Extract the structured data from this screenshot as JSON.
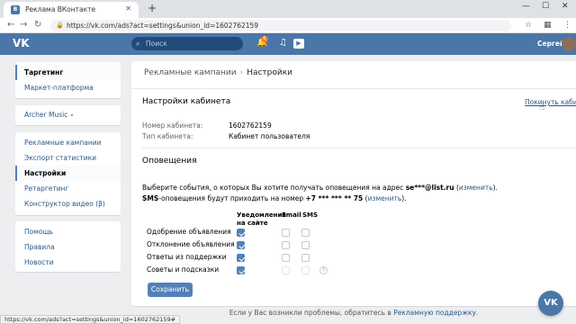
{
  "browser": {
    "tab_title": "Реклама ВКонтакте",
    "url": "https://vk.com/ads?act=settings&union_id=1602762159",
    "status_url": "https://vk.com/ads?act=settings&union_id=1602762159#"
  },
  "header": {
    "logo": "VK",
    "search_placeholder": "Поиск",
    "notifications_count": "6",
    "username": "Сергей",
    "brand_color": "#4a76a8"
  },
  "sidebar": {
    "group1": [
      "Таргетинг",
      "Маркет-платформа"
    ],
    "account": "Archer Music",
    "group2": [
      "Рекламные кампании",
      "Экспорт статистики",
      "Настройки",
      "Ретаргетинг",
      "Конструктор видео (β)"
    ],
    "group3": [
      "Помощь",
      "Правила",
      "Новости"
    ]
  },
  "main": {
    "breadcrumb": [
      "Рекламные кампании",
      "Настройки"
    ],
    "cabinet_settings_title": "Настройки кабинета",
    "leave_link": "Покинуть кабинет",
    "cabinet_number_label": "Номер кабинета:",
    "cabinet_number_value": "1602762159",
    "cabinet_type_label": "Тип кабинета:",
    "cabinet_type_value": "Кабинет пользователя",
    "notifications_title": "Оповещения",
    "email_line": {
      "prefix": "Выберите события, о которых Вы хотите получать оповещения на адрес ",
      "email": "se***@list.ru",
      "open": " (",
      "change": "изменить",
      "close": ")."
    },
    "sms_line": {
      "sms": "SMS",
      "middle": "-оповещения будут приходить на номер ",
      "phone": "+7 *** *** ** 75",
      "open": " (",
      "change": "изменить",
      "close": ")."
    },
    "columns": {
      "site": "Уведомления на сайте",
      "email": "Email",
      "sms": "SMS"
    },
    "rows": [
      {
        "label": "Одобрение объявления",
        "site": true,
        "email": false,
        "sms": false
      },
      {
        "label": "Отклонение объявления",
        "site": true,
        "email": false,
        "sms": false
      },
      {
        "label": "Ответы из поддержки",
        "site": true,
        "email": false,
        "sms": false
      },
      {
        "label": "Советы и подсказки",
        "site": true,
        "email": false,
        "sms": false
      }
    ],
    "help_mark": "?",
    "save_button": "Сохранить"
  },
  "footer": {
    "text": "Если у Вас возникли проблемы, обратитесь в ",
    "link": "Рекламную поддержку",
    "end": "."
  },
  "fab_label": "VK"
}
